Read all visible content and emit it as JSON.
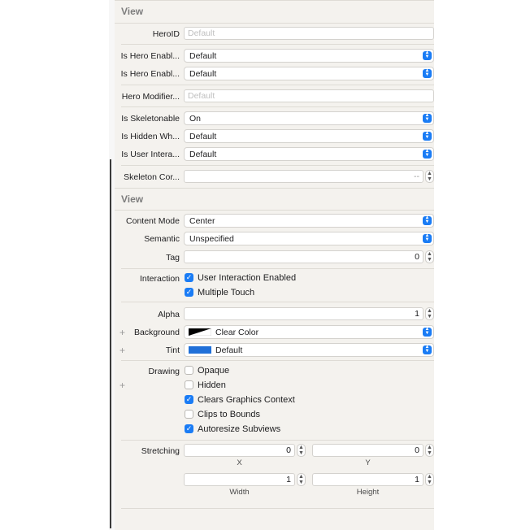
{
  "sections": {
    "view1_title": "View",
    "view2_title": "View"
  },
  "hero": {
    "heroid_label": "HeroID",
    "heroid_placeholder": "Default",
    "enabled1_label": "Is Hero Enabl...",
    "enabled1_value": "Default",
    "enabled2_label": "Is Hero Enabl...",
    "enabled2_value": "Default",
    "modifier_label": "Hero Modifier...",
    "modifier_placeholder": "Default"
  },
  "skeleton": {
    "skeletonable_label": "Is Skeletonable",
    "skeletonable_value": "On",
    "hidden_label": "Is Hidden Wh...",
    "hidden_value": "Default",
    "user_inter_label": "Is User Intera...",
    "user_inter_value": "Default",
    "corner_label": "Skeleton Cor...",
    "corner_value": "--"
  },
  "view": {
    "content_mode_label": "Content Mode",
    "content_mode_value": "Center",
    "semantic_label": "Semantic",
    "semantic_value": "Unspecified",
    "tag_label": "Tag",
    "tag_value": "0",
    "interaction_label": "Interaction",
    "user_interaction_label": "User Interaction Enabled",
    "user_interaction_checked": true,
    "multiple_touch_label": "Multiple Touch",
    "multiple_touch_checked": true,
    "alpha_label": "Alpha",
    "alpha_value": "1",
    "background_label": "Background",
    "background_value": "Clear Color",
    "tint_label": "Tint",
    "tint_value": "Default",
    "tint_color": "#1f6fd8",
    "drawing_label": "Drawing",
    "opaque_label": "Opaque",
    "opaque_checked": false,
    "hidden_label": "Hidden",
    "hidden_checked": false,
    "clears_label": "Clears Graphics Context",
    "clears_checked": true,
    "clips_label": "Clips to Bounds",
    "clips_checked": false,
    "autoresize_label": "Autoresize Subviews",
    "autoresize_checked": true,
    "stretching_label": "Stretching",
    "stretch_x": "0",
    "stretch_y": "0",
    "stretch_x_label": "X",
    "stretch_y_label": "Y",
    "stretch_w": "1",
    "stretch_h": "1",
    "stretch_w_label": "Width",
    "stretch_h_label": "Height"
  },
  "plus_glyph": "+",
  "accent_color": "#1a7cf5"
}
